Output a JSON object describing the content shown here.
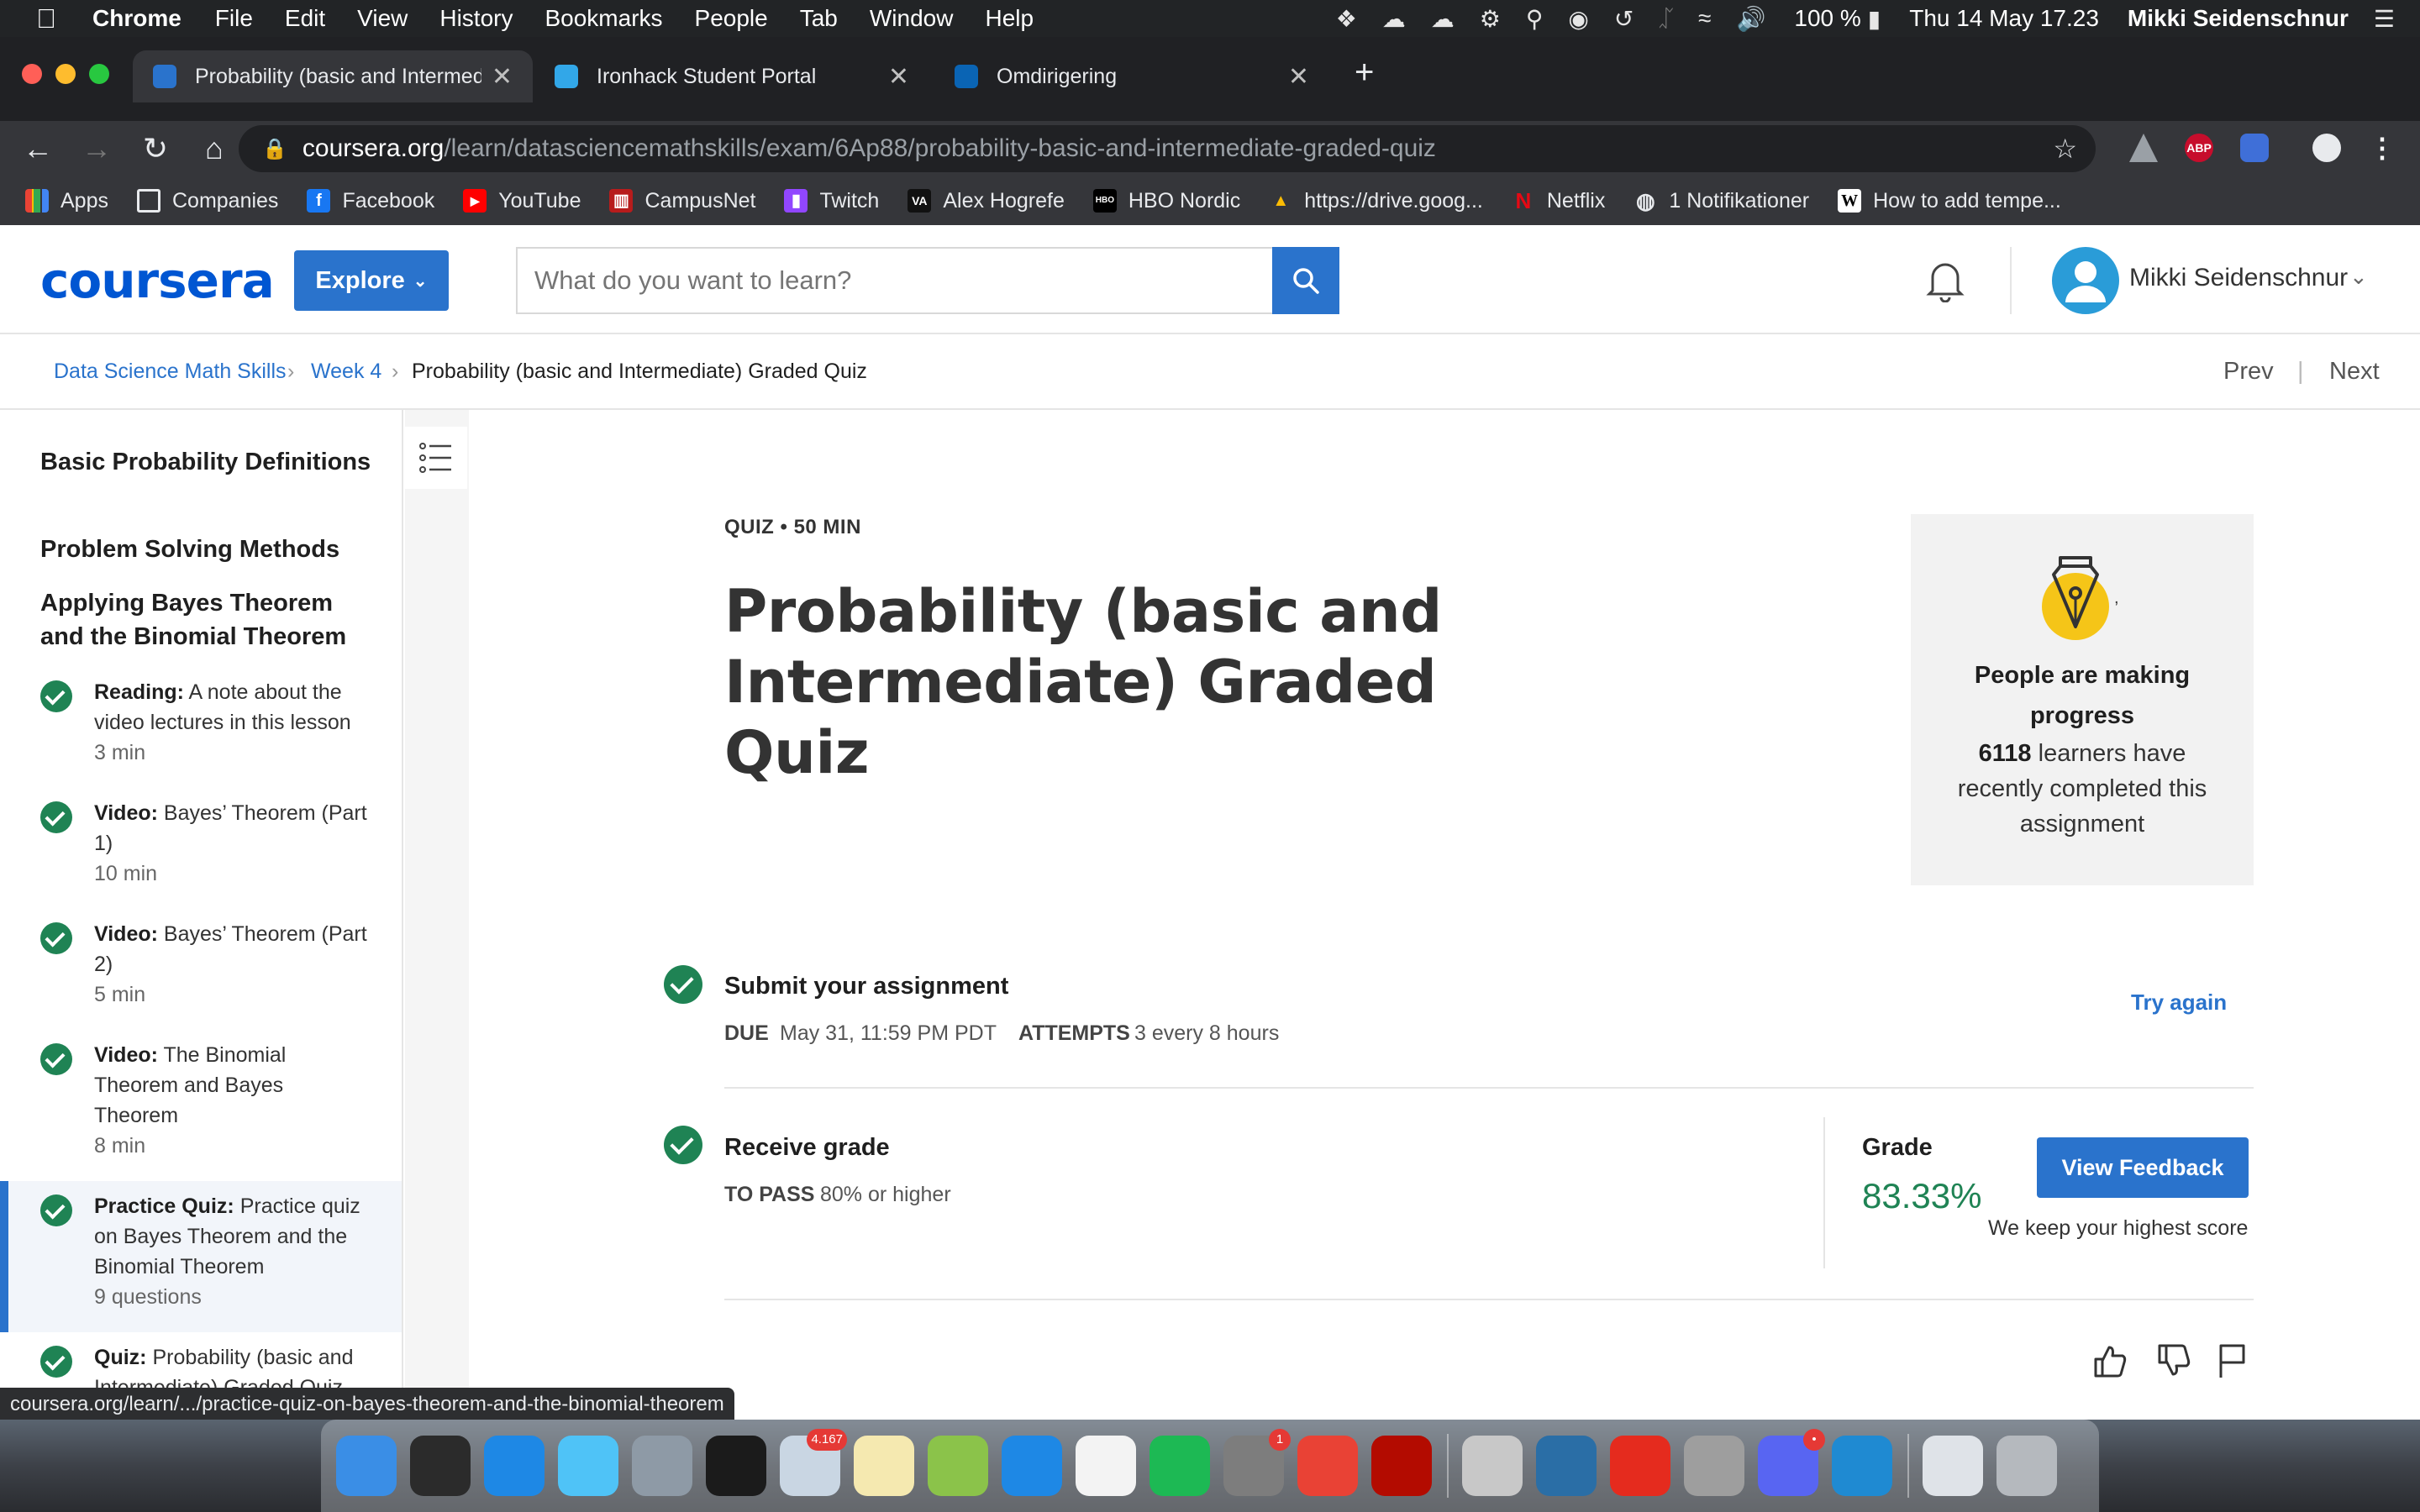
{
  "menubar": {
    "app_name": "Chrome",
    "menus": [
      "File",
      "Edit",
      "View",
      "History",
      "Bookmarks",
      "People",
      "Tab",
      "Window",
      "Help"
    ],
    "battery": "100 %",
    "datetime": "Thu 14 May  17.23",
    "user": "Mikki Seidenschnur"
  },
  "tabs": [
    {
      "title": "Probability (basic and Intermedi",
      "active": true,
      "favicon_color": "#2a73cc"
    },
    {
      "title": "Ironhack Student Portal",
      "active": false,
      "favicon_color": "#32a7e8"
    },
    {
      "title": "Omdirigering",
      "active": false,
      "favicon_color": "#0a64b4"
    }
  ],
  "address_bar": {
    "host": "coursera.org",
    "path": "/learn/datasciencemathskills/exam/6Ap88/probability-basic-and-intermediate-graded-quiz",
    "extension_abp": "ABP"
  },
  "bookmarks": [
    {
      "label": "Apps",
      "icon": "apps-grid-icon",
      "color": "#4285f4"
    },
    {
      "label": "Companies",
      "icon": "folder-icon",
      "color": "#9aa0a6"
    },
    {
      "label": "Facebook",
      "icon": "facebook-icon",
      "color": "#1877f2",
      "glyph": "f"
    },
    {
      "label": "YouTube",
      "icon": "youtube-icon",
      "color": "#ff0000",
      "glyph": "▶"
    },
    {
      "label": "CampusNet",
      "icon": "campusnet-icon",
      "color": "#b71c1c",
      "glyph": "▥"
    },
    {
      "label": "Twitch",
      "icon": "twitch-icon",
      "color": "#9146ff",
      "glyph": "▮"
    },
    {
      "label": "Alex Hogrefe",
      "icon": "va-icon",
      "color": "#111111",
      "glyph": "VA"
    },
    {
      "label": "HBO Nordic",
      "icon": "hbo-icon",
      "color": "#000000",
      "glyph": "HBO"
    },
    {
      "label": "https://drive.goog...",
      "icon": "google-drive-icon",
      "color": "#fbbc04",
      "glyph": "▲"
    },
    {
      "label": "Netflix",
      "icon": "netflix-icon",
      "color": "#35363a",
      "glyph": "N"
    },
    {
      "label": "1 Notifikationer",
      "icon": "globe-icon",
      "color": "#35363a",
      "glyph": "◍"
    },
    {
      "label": "How to add tempe...",
      "icon": "wikipedia-icon",
      "color": "#ffffff",
      "glyph": "W"
    }
  ],
  "header": {
    "logo": "coursera",
    "explore_label": "Explore",
    "search_placeholder": "What do you want to learn?",
    "user_name": "Mikki Seidenschnur"
  },
  "breadcrumb": {
    "items": [
      "Data Science Math Skills",
      "Week 4"
    ],
    "current": "Probability (basic and Intermediate) Graded Quiz",
    "prev": "Prev",
    "next": "Next"
  },
  "sidebar": {
    "lessons": [
      "Basic Probability Definitions",
      "Problem Solving Methods",
      "Applying Bayes Theorem and the Binomial Theorem"
    ],
    "items": [
      {
        "type": "Reading:",
        "title": "A note about the video lectures in this lesson",
        "duration": "3 min"
      },
      {
        "type": "Video:",
        "title": "Bayes’ Theorem (Part 1)",
        "duration": "10 min"
      },
      {
        "type": "Video:",
        "title": "Bayes’ Theorem (Part 2)",
        "duration": "5 min"
      },
      {
        "type": "Video:",
        "title": "The Binomial Theorem and Bayes Theorem",
        "duration": "8 min"
      },
      {
        "type": "Practice Quiz:",
        "title": "Practice quiz on Bayes Theorem and the Binomial Theorem",
        "duration": "9 questions"
      },
      {
        "type": "Quiz:",
        "title": "Probability (basic and Intermediate) Graded Quiz",
        "duration": ""
      }
    ]
  },
  "quiz": {
    "meta": "QUIZ • 50 MIN",
    "title": "Probability (basic and Intermediate) Graded Quiz"
  },
  "progress_card": {
    "title": "People are making progress",
    "count": "6118",
    "body": "learners have recently completed this assignment"
  },
  "submit": {
    "title": "Submit your assignment",
    "due_label": "DUE",
    "due_value": "May 31, 11:59 PM PDT",
    "attempts_label": "ATTEMPTS",
    "attempts_value": "3 every 8 hours",
    "try_again": "Try again"
  },
  "receive": {
    "title": "Receive grade",
    "pass_label": "TO PASS",
    "pass_value": "80% or higher",
    "grade_label": "Grade",
    "grade_value": "83.33%",
    "view_feedback": "View Feedback",
    "highest": "We keep your highest score"
  },
  "status_url": "coursera.org/learn/.../practice-quiz-on-bayes-theorem-and-the-binomial-theorem",
  "dock": {
    "apps": [
      {
        "name": "finder-icon",
        "color": "#3a8ee6"
      },
      {
        "name": "activity-icon",
        "color": "#2b2b2b"
      },
      {
        "name": "onedrive-icon",
        "color": "#1e88e5"
      },
      {
        "name": "messages-icon",
        "color": "#4fc3f7"
      },
      {
        "name": "launchpad-icon",
        "color": "#8e9aa6"
      },
      {
        "name": "terminal-icon",
        "color": "#1b1b1b"
      },
      {
        "name": "mail-icon",
        "color": "#c9d6e3",
        "badge": "4.167"
      },
      {
        "name": "notes-icon",
        "color": "#f5e9b0"
      },
      {
        "name": "maps-icon",
        "color": "#8bc34a"
      },
      {
        "name": "app-store-icon",
        "color": "#1e88e5"
      },
      {
        "name": "photos-icon",
        "color": "#f3f3f3"
      },
      {
        "name": "spotify-icon",
        "color": "#1db954"
      },
      {
        "name": "system-preferences-icon",
        "color": "#7d7d7d",
        "badge": "1"
      },
      {
        "name": "chrome-icon",
        "color": "#e94235"
      },
      {
        "name": "acrobat-icon",
        "color": "#b30b00"
      },
      {
        "name": "sequel-icon",
        "color": "#c8c8c8"
      },
      {
        "name": "mysql-workbench-icon",
        "color": "#2a6ea6"
      },
      {
        "name": "acrobat-reader-icon",
        "color": "#e52b1e"
      },
      {
        "name": "calculator-icon",
        "color": "#9e9e9e"
      },
      {
        "name": "discord-icon",
        "color": "#5865f2",
        "badge": "•"
      },
      {
        "name": "vscode-icon",
        "color": "#1f8ad2"
      },
      {
        "name": "downloads-folder-icon",
        "color": "#dfe3e8"
      },
      {
        "name": "trash-icon",
        "color": "#b5b9be"
      }
    ]
  },
  "colors": {
    "coursera_blue": "#2a73cc",
    "success_green": "#1f8354",
    "chrome_dark": "#35363a"
  }
}
